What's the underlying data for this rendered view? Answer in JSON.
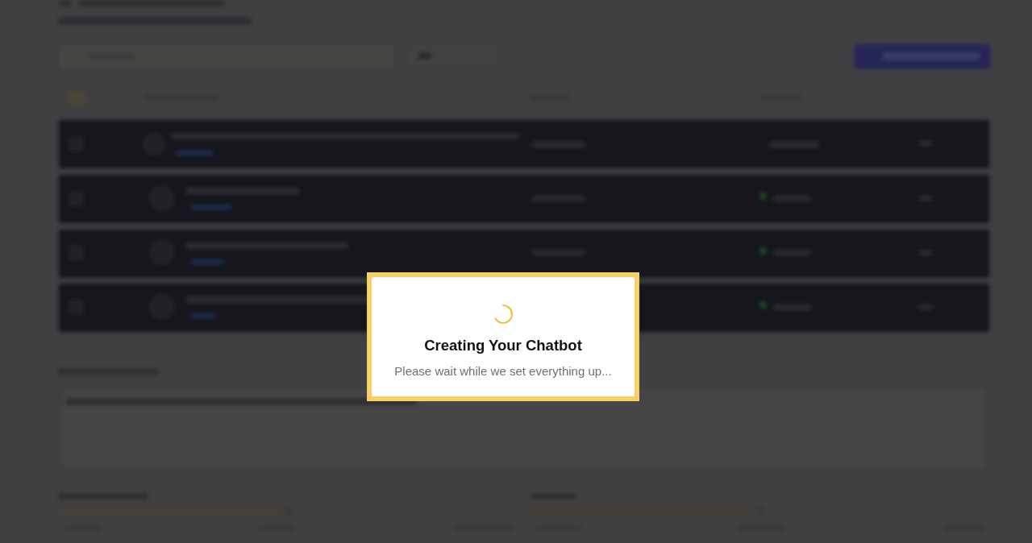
{
  "modal": {
    "title": "Creating Your Chatbot",
    "message": "Please wait while we set everything up..."
  }
}
